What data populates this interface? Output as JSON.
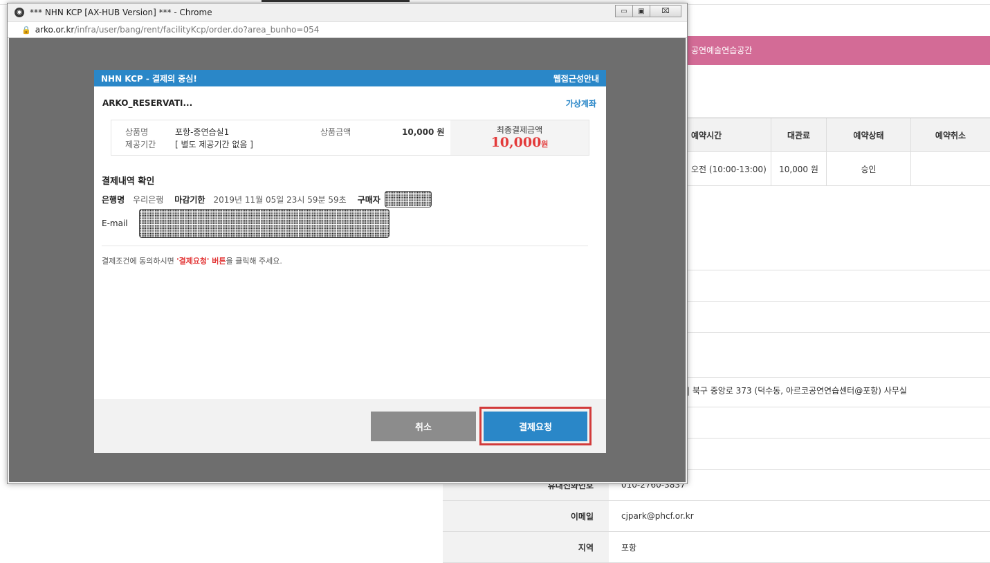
{
  "background": {
    "banner_text": "공연예술연습공간",
    "table": {
      "headers": [
        "예약시간",
        "대관료",
        "예약상태",
        "예약취소"
      ],
      "row": [
        "오전 (10:00-13:00)",
        "10,000 원",
        "승인",
        ""
      ]
    },
    "address": "| 북구 중앙로 373 (덕수동, 아르코공연연습센터@포항) 사무실",
    "info_rows": [
      {
        "label": "휴대전화번호",
        "value": "010-2760-3837"
      },
      {
        "label": "이메일",
        "value": "cjpark@phcf.or.kr"
      },
      {
        "label": "지역",
        "value": "포항"
      }
    ]
  },
  "window": {
    "title": "*** NHN KCP [AX-HUB Version] *** - Chrome",
    "url_domain": "arko.or.kr",
    "url_path": "/infra/user/bang/rent/facilityKcp/order.do?area_bunho=054",
    "controls": {
      "minimize": "▭",
      "maximize": "▣",
      "close": "⌧"
    }
  },
  "modal": {
    "header_title": "NHN KCP - 결제의 중심!",
    "header_link": "웹접근성안내",
    "merchant": "ARKO_RESERVATI...",
    "method": "가상계좌",
    "goods": {
      "name_label": "상품명",
      "name_value": "포항-중연습실1",
      "period_label": "제공기간",
      "period_value": "[ 별도 제공기간 없음 ]",
      "price_label": "상품금액",
      "price_value": "10,000 원",
      "total_label": "최종결제금액",
      "total_amount": "10,000",
      "total_unit": "원"
    },
    "section_title": "결제내역 확인",
    "bank_label": "은행명",
    "bank_value": "우리은행",
    "deadline_label": "마감기한",
    "deadline_value": "2019년 11월 05일 23시 59분 59초",
    "buyer_label": "구매자",
    "email_label": "E-mail",
    "notice_before": "결제조건에 동의하시면 ",
    "notice_highlight": "'결제요청' 버튼",
    "notice_after": "을 클릭해 주세요.",
    "cancel_label": "취소",
    "pay_label": "결제요청"
  }
}
